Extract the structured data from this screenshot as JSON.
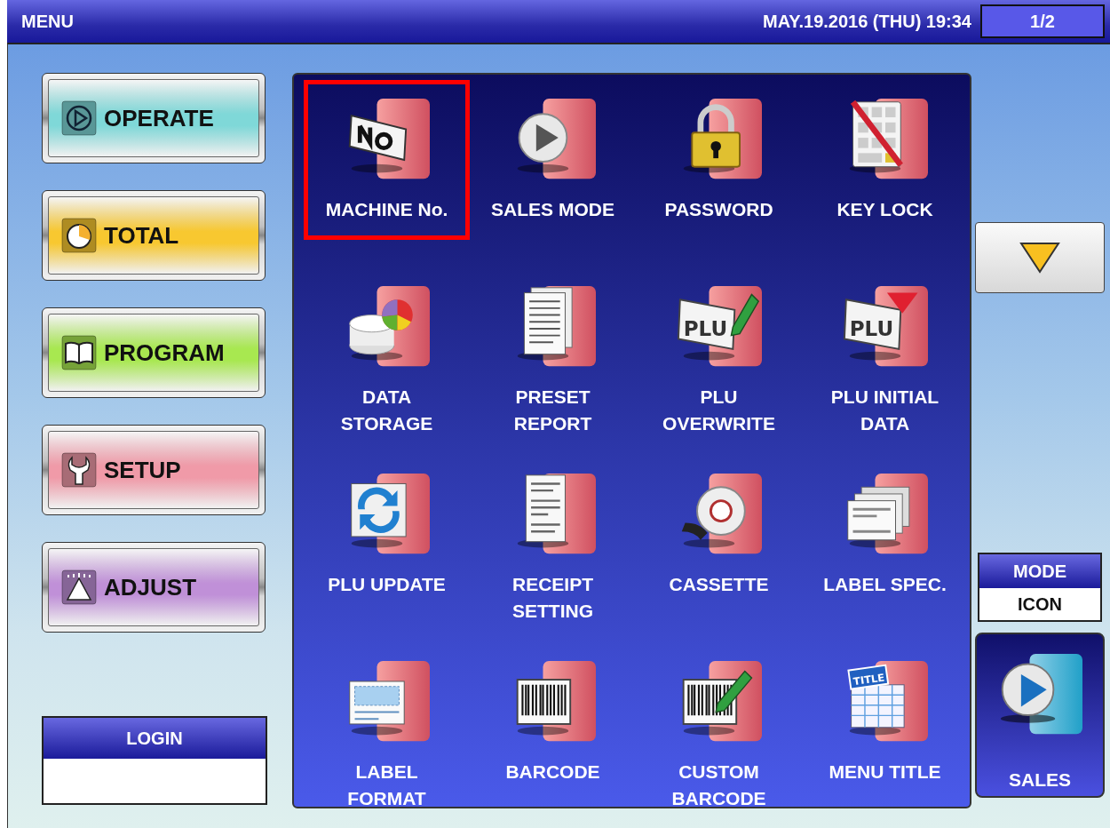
{
  "title_bar": {
    "title": "MENU",
    "datetime": "MAY.19.2016 (THU)  19:34",
    "page": "1/2"
  },
  "sidebar": {
    "items": [
      {
        "label": "OPERATE",
        "kind": "play-circle",
        "color": "#7fd8d8"
      },
      {
        "label": "TOTAL",
        "kind": "pie",
        "color": "#f8c830"
      },
      {
        "label": "PROGRAM",
        "kind": "book",
        "color": "#a8e850"
      },
      {
        "label": "SETUP",
        "kind": "wrench",
        "color": "#f09aa8"
      },
      {
        "label": "ADJUST",
        "kind": "meter",
        "color": "#c090d8"
      }
    ]
  },
  "login": {
    "label": "LOGIN"
  },
  "menu": {
    "items": [
      {
        "label": "MACHINE No.",
        "kind": "number-plate",
        "selected": true
      },
      {
        "label": "SALES MODE",
        "kind": "play",
        "selected": false
      },
      {
        "label": "PASSWORD",
        "kind": "padlock",
        "selected": false
      },
      {
        "label": "KEY LOCK",
        "kind": "keypad",
        "selected": false
      },
      {
        "label": "DATA\nSTORAGE",
        "kind": "disk",
        "selected": false
      },
      {
        "label": "PRESET\nREPORT",
        "kind": "document",
        "selected": false
      },
      {
        "label": "PLU\nOVERWRITE",
        "kind": "plu-pencil",
        "icon_text": "PLU",
        "selected": false
      },
      {
        "label": "PLU INITIAL\nDATA",
        "kind": "plu-arrow",
        "icon_text": "PLU",
        "selected": false
      },
      {
        "label": "PLU UPDATE",
        "kind": "refresh",
        "selected": false
      },
      {
        "label": "RECEIPT\nSETTING",
        "kind": "receipt",
        "selected": false
      },
      {
        "label": "CASSETTE",
        "kind": "roll",
        "selected": false
      },
      {
        "label": "LABEL SPEC.",
        "kind": "labels",
        "selected": false
      },
      {
        "label": "LABEL\nFORMAT",
        "kind": "label",
        "selected": false
      },
      {
        "label": "BARCODE",
        "kind": "barcode",
        "selected": false
      },
      {
        "label": "CUSTOM\nBARCODE",
        "kind": "barcode-pencil",
        "selected": false
      },
      {
        "label": "MENU TITLE",
        "kind": "title",
        "icon_text": "TITLE",
        "selected": false
      }
    ]
  },
  "mode": {
    "label": "MODE",
    "value": "ICON"
  },
  "sales_button": {
    "label": "SALES"
  }
}
